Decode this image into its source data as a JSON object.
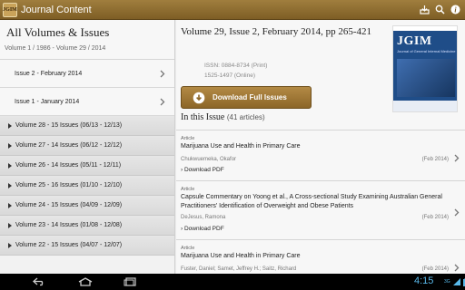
{
  "app": {
    "logo_text": "JGIM",
    "title": "Journal Content",
    "action_icons": [
      "download-icon",
      "search-icon",
      "info-icon"
    ]
  },
  "left": {
    "title": "All Volumes & Issues",
    "subtitle": "Volume 1 / 1986 - Volume 29 / 2014",
    "issues": [
      {
        "label": "Issue 2 - February 2014"
      },
      {
        "label": "Issue 1 - January 2014"
      }
    ],
    "volumes": [
      {
        "label": "Volume 28 - 15 Issues (06/13  -  12/13)"
      },
      {
        "label": "Volume 27 - 14 Issues (06/12  -  12/12)"
      },
      {
        "label": "Volume 26 - 14 Issues (05/11  -  12/11)"
      },
      {
        "label": "Volume 25 - 16 Issues (01/10  -  12/10)"
      },
      {
        "label": "Volume 24 - 15 Issues (04/09  -  12/09)"
      },
      {
        "label": "Volume 23 - 14 Issues (01/08  -  12/08)"
      },
      {
        "label": "Volume 22 - 15 Issues (04/07  -  12/07)"
      }
    ]
  },
  "right": {
    "volume_title": "Volume 29, Issue 2, February 2014, pp 265-421",
    "issn_print": "ISSN: 0884-8734 (Print)",
    "issn_online": "1525-1497 (Online)",
    "cover_name": "JGIM",
    "cover_subtitle": "Journal of General Internal Medicine",
    "download_label": "Download Full Issues",
    "in_issue_label": "In this Issue",
    "article_count": "(41 articles)",
    "articles": [
      {
        "type": "Article",
        "title": "Marijuana Use and Health in Primary Care",
        "author": "Chukwuemeka, Okafor",
        "date": "(Feb 2014)",
        "pdf": "› Download PDF"
      },
      {
        "type": "Article",
        "title": "Capsule Commentary on Yoong et al., A Cross-sectional Study Examining Australian General Practitioners' Identification of Overweight and Obese Patients",
        "author": "DeJesus, Ramona",
        "date": "(Feb 2014)",
        "pdf": "› Download PDF"
      },
      {
        "type": "Article",
        "title": "Marijuana Use and Health in Primary Care",
        "author": "Fuster, Daniel; Samet, Jeffrey H.; Saitz, Richard",
        "date": "(Feb 2014)",
        "pdf": ""
      }
    ]
  },
  "system": {
    "clock": "4:15",
    "signal": "3G"
  },
  "colors": {
    "actionbar": "#8f6c2e",
    "button": "#a07c3a",
    "clock": "#58b7e8"
  }
}
